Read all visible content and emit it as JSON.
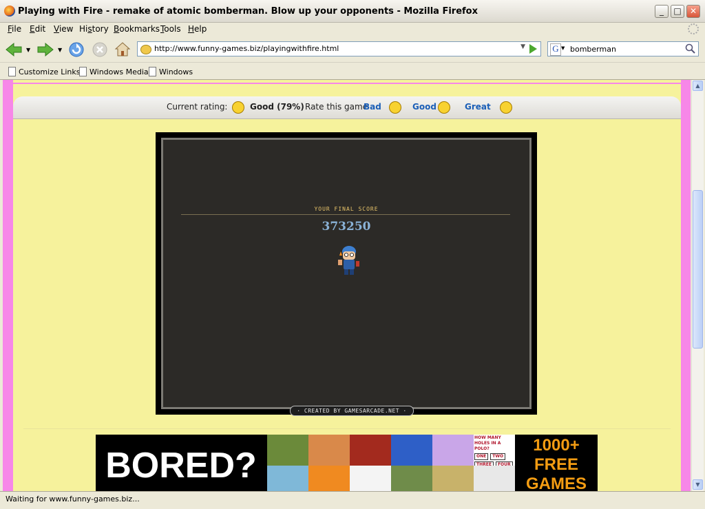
{
  "window": {
    "title": "Playing with Fire - remake of atomic bomberman. Blow up your opponents - Mozilla Firefox",
    "controls": {
      "minimize": "_",
      "maximize": "□",
      "close": "✕"
    }
  },
  "menu": {
    "items": [
      {
        "label": "File",
        "key": "F",
        "rest": "ile"
      },
      {
        "label": "Edit",
        "key": "E",
        "rest": "dit"
      },
      {
        "label": "View",
        "key": "V",
        "rest": "iew"
      },
      {
        "label": "History",
        "key": "",
        "pre": "Hi",
        "key2": "s",
        "rest": "tory"
      },
      {
        "label": "Bookmarks",
        "key": "B",
        "rest": "ookmarks"
      },
      {
        "label": "Tools",
        "key": "T",
        "rest": "ools"
      },
      {
        "label": "Help",
        "key": "H",
        "rest": "elp"
      }
    ]
  },
  "nav": {
    "url": "http://www.funny-games.biz/playingwithfire.html",
    "search_engine": "G",
    "search_value": "bomberman",
    "icons": [
      "back-icon",
      "forward-icon",
      "reload-icon",
      "stop-icon",
      "home-icon",
      "go-icon",
      "search-icon"
    ]
  },
  "bookmarks": {
    "items": [
      "Customize Links",
      "Windows Media",
      "Windows"
    ]
  },
  "page": {
    "rating": {
      "label": "Current rating:",
      "value": "Good (79%)",
      "rate_label": "Rate this game",
      "options": [
        "Bad",
        "Good",
        "Great"
      ]
    },
    "game": {
      "score_label": "YOUR FINAL SCORE",
      "score": "373250",
      "credit": "· CREATED BY GAMESARCADE.NET ·"
    },
    "banner": {
      "headline": "BORED?",
      "promo_line1": "1000+",
      "promo_line2": "FREE",
      "promo_line3": "GAMES",
      "thumb_text": [
        "HOW MANY HOLES IN A POLO?",
        "ONE",
        "TWO",
        "THREE",
        "FOUR"
      ]
    },
    "colors": {
      "background": "#f787e8",
      "panel": "#f6f29c",
      "game_bg": "#2c2a27",
      "score": "#8ab2d7",
      "promo": "#f39c12"
    }
  },
  "status": {
    "text": "Waiting for www.funny-games.biz..."
  }
}
